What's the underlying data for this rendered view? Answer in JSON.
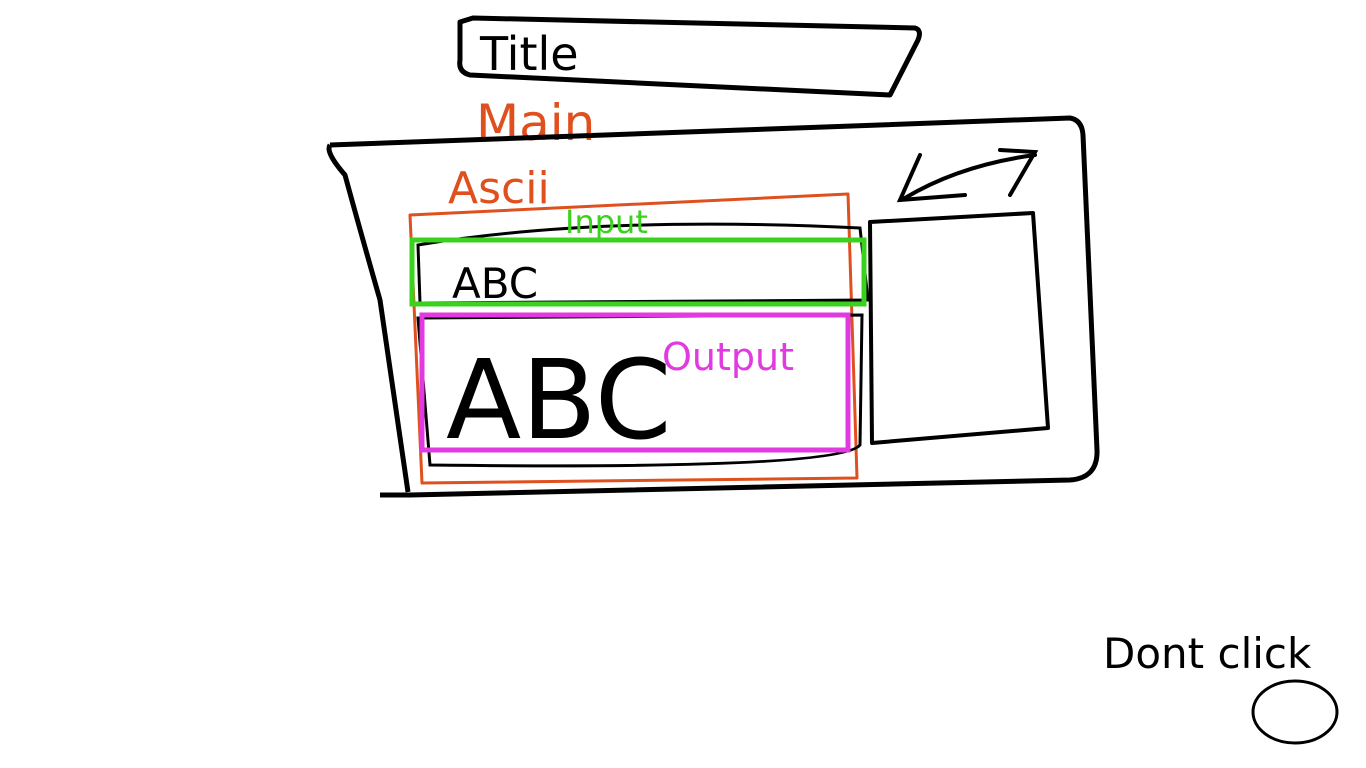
{
  "title": {
    "text": "Title"
  },
  "annotations": {
    "main": "Main",
    "ascii": "Ascii",
    "input": "Input",
    "output": "Output"
  },
  "input_field": {
    "value": "ABC"
  },
  "output_display": {
    "value": "ABC"
  },
  "dont_click": {
    "label": "Dont click"
  },
  "colors": {
    "ink": "#000000",
    "main_annotation": "#e0501e",
    "input_annotation": "#3ad11f",
    "output_annotation": "#e03ae0"
  },
  "icons": {
    "swap": "swap-arrows-icon",
    "dont_click_button": "circle-button"
  }
}
